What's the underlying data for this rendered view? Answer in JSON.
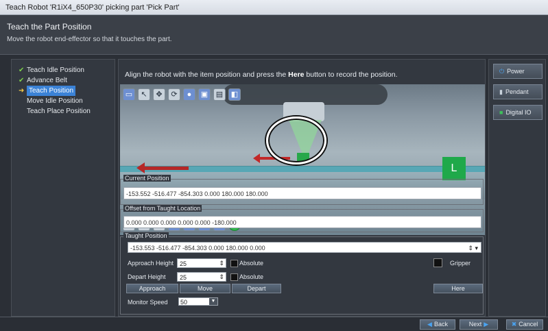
{
  "window_title": "Teach Robot 'R1iX4_650P30' picking part 'Pick Part'",
  "header": {
    "title": "Teach the Part Position",
    "subtitle": "Move the robot end-effector so that it touches the part."
  },
  "steps": [
    {
      "label": "Teach Idle Position",
      "done": true
    },
    {
      "label": "Advance Belt",
      "done": true
    },
    {
      "label": "Teach Position",
      "active": true
    },
    {
      "label": "Move Idle Position"
    },
    {
      "label": "Teach Place Position"
    }
  ],
  "instruction": {
    "before": "Align the robot with the item position and press the ",
    "bold": "Here",
    "after": " button to record the position."
  },
  "viewport": {
    "marker_label": "L"
  },
  "current_position": {
    "legend": "Current Position",
    "value": "-153.552 -516.477 -854.303 0.000 180.000 180.000"
  },
  "offset": {
    "legend": "Offset from Taught Location",
    "value": "0.000 0.000 0.000 0.000 0.000 -180.000"
  },
  "taught": {
    "legend": "Taught Position",
    "value": "-153.553 -516.477 -854.303 0.000 180.000 0.000",
    "approach_height_label": "Approach Height",
    "approach_height_value": "25",
    "depart_height_label": "Depart Height",
    "depart_height_value": "25",
    "absolute_label": "Absolute",
    "gripper_label": "Gripper",
    "approach_button": "Approach",
    "move_button": "Move",
    "depart_button": "Depart",
    "here_button": "Here",
    "monitor_speed_label": "Monitor Speed",
    "monitor_speed_value": "50"
  },
  "side_buttons": {
    "power": "Power",
    "pendant": "Pendant",
    "digital_io": "Digital IO"
  },
  "footer": {
    "back": "Back",
    "next": "Next",
    "cancel": "Cancel"
  }
}
